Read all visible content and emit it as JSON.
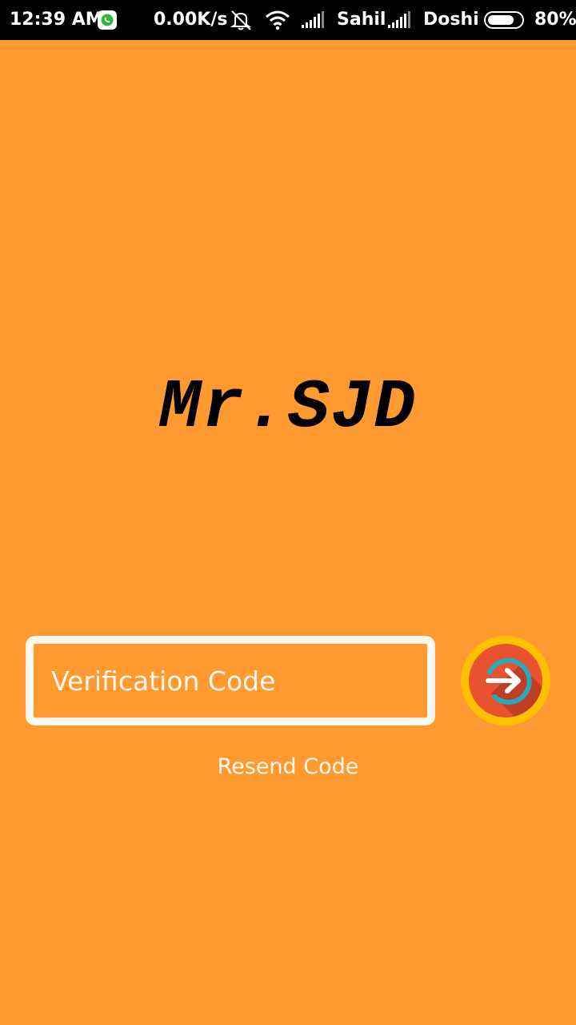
{
  "status_bar": {
    "time": "12:39 AM",
    "network_speed": "0.00K/s",
    "carrier_1": "Sahil",
    "carrier_2": "Doshi",
    "battery_percent": "80%",
    "battery_level": 0.8,
    "icons": [
      "whatsapp-icon",
      "mute-icon",
      "wifi-icon",
      "signal-icon",
      "signal-icon",
      "battery-icon"
    ]
  },
  "app": {
    "title": "Mr.SJD",
    "background_color": "#FF9A30"
  },
  "verification": {
    "placeholder": "Verification Code",
    "value": "",
    "resend_label": "Resend Code",
    "submit_icon": "arrow-right-icon",
    "submit_colors": {
      "ring": "#FFC000",
      "inner": "#E8522E",
      "arc": "#2AA9B8"
    }
  }
}
